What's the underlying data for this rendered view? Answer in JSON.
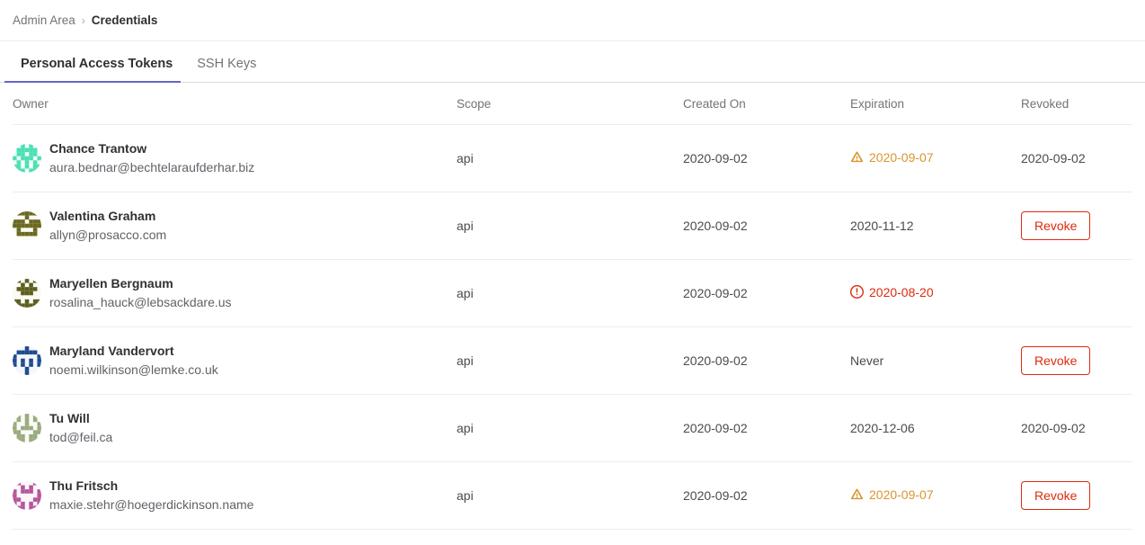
{
  "breadcrumb": {
    "root_label": "Admin Area",
    "separator": "›",
    "current_label": "Credentials"
  },
  "tabs": [
    {
      "label": "Personal Access Tokens",
      "active": true
    },
    {
      "label": "SSH Keys",
      "active": false
    }
  ],
  "table": {
    "columns": {
      "owner": "Owner",
      "scope": "Scope",
      "created_on": "Created On",
      "expiration": "Expiration",
      "revoked": "Revoked"
    },
    "rows": [
      {
        "name": "Chance Trantow",
        "email": "aura.bednar@bechtelaraufderhar.biz",
        "scope": "api",
        "created_on": "2020-09-02",
        "expiration": "2020-09-07",
        "expiration_state": "warning",
        "expiration_icon": "warning-triangle-icon",
        "revoked": "2020-09-02",
        "revoked_is_button": false,
        "avatar": {
          "seed": 11,
          "color": "#4ce0b3",
          "bg": "#f2fdfa"
        }
      },
      {
        "name": "Valentina Graham",
        "email": "allyn@prosacco.com",
        "scope": "api",
        "created_on": "2020-09-02",
        "expiration": "2020-11-12",
        "expiration_state": "normal",
        "expiration_icon": "",
        "revoked": "Revoke",
        "revoked_is_button": true,
        "avatar": {
          "seed": 29,
          "color": "#6b6a21",
          "bg": "#fbfbf4"
        }
      },
      {
        "name": "Maryellen Bergnaum",
        "email": "rosalina_hauck@lebsackdare.us",
        "scope": "api",
        "created_on": "2020-09-02",
        "expiration": "2020-08-20",
        "expiration_state": "expired",
        "expiration_icon": "error-circle-icon",
        "revoked": "",
        "revoked_is_button": false,
        "avatar": {
          "seed": 41,
          "color": "#5d5f20",
          "bg": "#fbfbf4"
        }
      },
      {
        "name": "Maryland Vandervort",
        "email": "noemi.wilkinson@lemke.co.uk",
        "scope": "api",
        "created_on": "2020-09-02",
        "expiration": "Never",
        "expiration_state": "normal",
        "expiration_icon": "",
        "revoked": "Revoke",
        "revoked_is_button": true,
        "avatar": {
          "seed": 53,
          "color": "#1f4b8e",
          "bg": "#f4f7fc"
        }
      },
      {
        "name": "Tu Will",
        "email": "tod@feil.ca",
        "scope": "api",
        "created_on": "2020-09-02",
        "expiration": "2020-12-06",
        "expiration_state": "normal",
        "expiration_icon": "",
        "revoked": "2020-09-02",
        "revoked_is_button": false,
        "avatar": {
          "seed": 67,
          "color": "#9aab7e",
          "bg": "#fafbf7"
        }
      },
      {
        "name": "Thu Fritsch",
        "email": "maxie.stehr@hoegerdickinson.name",
        "scope": "api",
        "created_on": "2020-09-02",
        "expiration": "2020-09-07",
        "expiration_state": "warning",
        "expiration_icon": "warning-triangle-icon",
        "revoked": "Revoke",
        "revoked_is_button": true,
        "avatar": {
          "seed": 83,
          "color": "#b4569a",
          "bg": "#fcf5fa"
        }
      }
    ]
  },
  "colors": {
    "accent": "#6666c4",
    "warning": "#d99530",
    "danger": "#dd2b0e",
    "text": "#303030",
    "muted": "#737278",
    "border": "#ececef"
  }
}
